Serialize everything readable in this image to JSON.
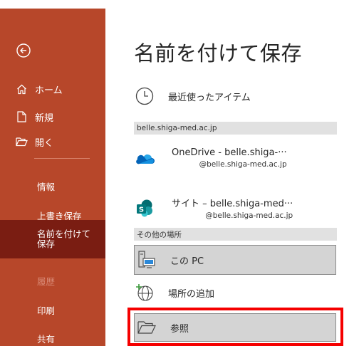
{
  "sidebar": {
    "back_label": "",
    "items": [
      {
        "label": "ホーム",
        "icon": "home-icon"
      },
      {
        "label": "新規",
        "icon": "new-document-icon"
      },
      {
        "label": "開く",
        "icon": "open-folder-icon"
      }
    ],
    "sub_items": [
      {
        "label": "情報"
      },
      {
        "label": "上書き保存"
      },
      {
        "label": "名前を付けて保存",
        "selected": true
      },
      {
        "label": "履歴",
        "disabled": true
      },
      {
        "label": "印刷"
      },
      {
        "label": "共有"
      }
    ]
  },
  "main": {
    "title": "名前を付けて保存",
    "recent": {
      "label": "最近使ったアイテム",
      "icon": "clock-icon"
    },
    "org_header": "belle.shiga-med.ac.jp",
    "onedrive": {
      "label": "OneDrive - belle.shiga-···",
      "sub": "@belle.shiga-med.ac.jp",
      "icon": "onedrive-icon"
    },
    "sites": {
      "label": "サイト – belle.shiga-med···",
      "sub": "@belle.shiga-med.ac.jp",
      "icon": "sharepoint-icon"
    },
    "other_header": "その他の場所",
    "this_pc": {
      "label": "この PC",
      "icon": "computer-icon"
    },
    "add_place": {
      "label": "場所の追加",
      "icon": "add-place-icon"
    },
    "browse": {
      "label": "参照",
      "icon": "browse-folder-icon"
    }
  },
  "colors": {
    "sidebar_bg": "#b7472a",
    "selected_bg": "#7a1d12",
    "highlight": "#f50000"
  }
}
